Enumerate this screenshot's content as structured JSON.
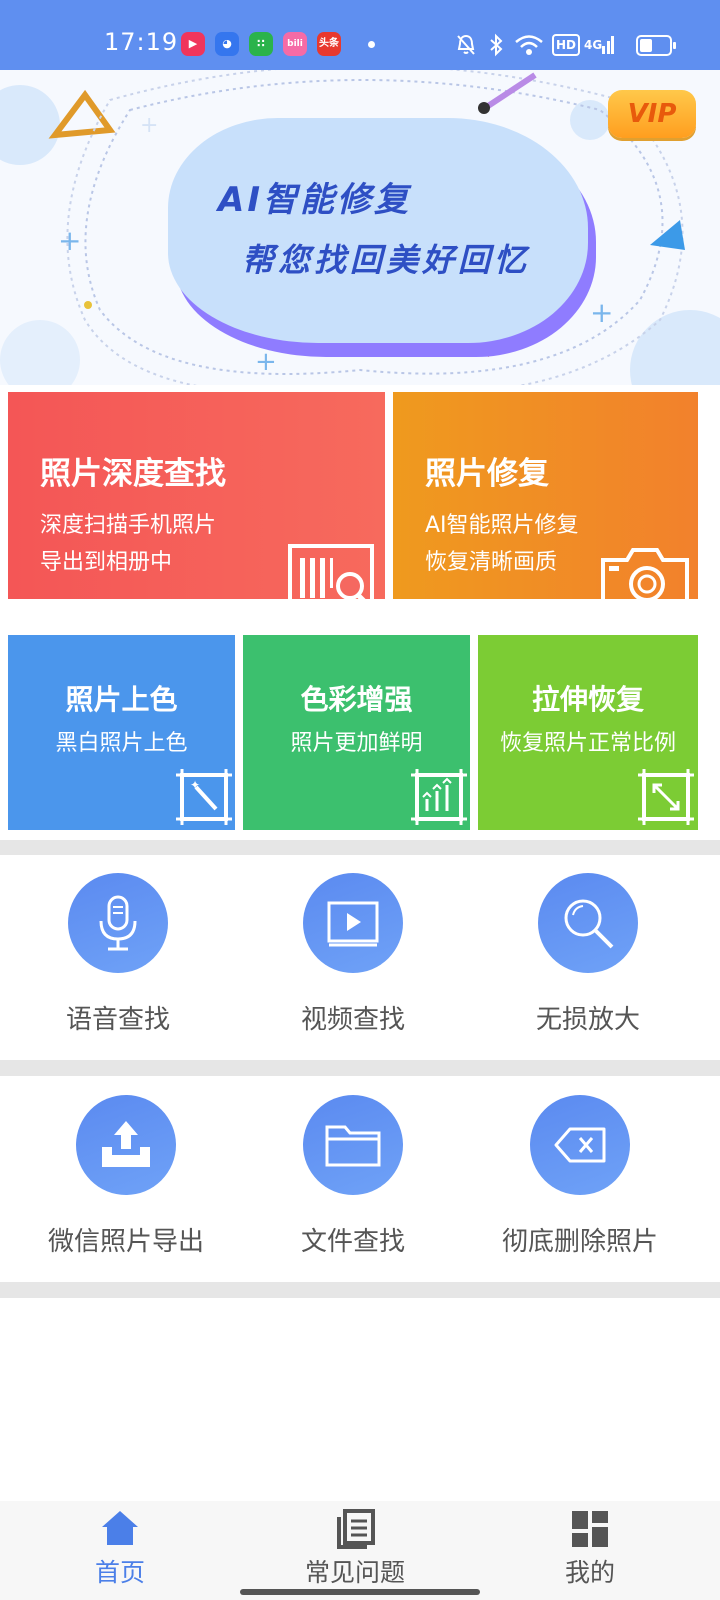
{
  "status_bar": {
    "time": "17:19",
    "notification_apps": [
      "video-app-icon",
      "baidu-app-icon",
      "wechat-app-icon",
      "bilibili-app-icon",
      "toutiao-app-icon"
    ],
    "toutiao_label": "头条",
    "bilibili_label": "bili",
    "hd_label": "HD",
    "network_label": "4G",
    "icons": [
      "mute-bell-icon",
      "bluetooth-icon",
      "wifi-icon",
      "hd-icon",
      "signal-4g-icon",
      "battery-icon"
    ]
  },
  "banner": {
    "title_line1": "AI智能修复",
    "title_line2": "帮您找回美好回忆",
    "vip_badge": "VIP"
  },
  "feature_cards": {
    "deep_search": {
      "title": "照片深度查找",
      "desc_line1": "深度扫描手机照片",
      "desc_line2": "导出到相册中",
      "color": "#f55a5a"
    },
    "photo_repair": {
      "title": "照片修复",
      "desc_line1": "AI智能照片修复",
      "desc_line2": "恢复清晰画质",
      "color": "#f08f22"
    },
    "colorize": {
      "title": "照片上色",
      "desc": "黑白照片上色",
      "color": "#4b96ec"
    },
    "enhance": {
      "title": "色彩增强",
      "desc": "照片更加鲜明",
      "color": "#3cc06e"
    },
    "stretch": {
      "title": "拉伸恢复",
      "desc": "恢复照片正常比例",
      "color": "#7ccc34"
    }
  },
  "tools_row1": [
    {
      "label": "语音查找",
      "icon": "microphone-icon"
    },
    {
      "label": "视频查找",
      "icon": "video-play-icon"
    },
    {
      "label": "无损放大",
      "icon": "magnifier-icon"
    }
  ],
  "tools_row2": [
    {
      "label": "微信照片导出",
      "icon": "upload-tray-icon"
    },
    {
      "label": "文件查找",
      "icon": "folder-icon"
    },
    {
      "label": "彻底删除照片",
      "icon": "delete-backspace-icon"
    }
  ],
  "bottom_nav": [
    {
      "label": "首页",
      "icon": "home-icon",
      "active": true
    },
    {
      "label": "常见问题",
      "icon": "faq-document-icon",
      "active": false
    },
    {
      "label": "我的",
      "icon": "profile-grid-icon",
      "active": false
    }
  ],
  "colors": {
    "accent": "#4b7fe8",
    "status_bar": "#5f8ff0"
  }
}
